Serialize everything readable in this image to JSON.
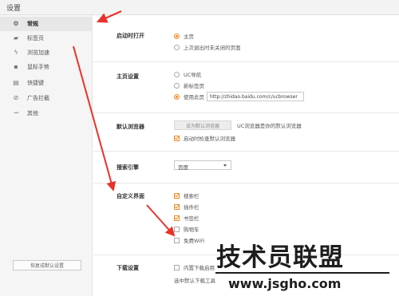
{
  "window": {
    "title": "设置"
  },
  "sidebar": {
    "items": [
      {
        "label": "常规",
        "icon": "gear-icon",
        "glyph": "⚙",
        "active": true
      },
      {
        "label": "标签页",
        "icon": "tab-icon",
        "glyph": "▰",
        "active": false
      },
      {
        "label": "浏览加速",
        "icon": "lightning-icon",
        "glyph": "ϟ",
        "active": false
      },
      {
        "label": "鼠标手势",
        "icon": "mouse-icon",
        "glyph": "▪",
        "active": false
      },
      {
        "label": "快捷键",
        "icon": "keyboard-icon",
        "glyph": "▤",
        "active": false
      },
      {
        "label": "广告拦截",
        "icon": "block-icon",
        "glyph": "⊘",
        "active": false
      },
      {
        "label": "其他",
        "icon": "more-icon",
        "glyph": "•••",
        "active": false
      }
    ],
    "restore_label": "恢复成默认设置"
  },
  "startup": {
    "label": "启动时打开",
    "options": [
      {
        "label": "主页",
        "selected": true
      },
      {
        "label": "上次退出时未关闭的页面",
        "selected": false
      }
    ]
  },
  "homepage": {
    "label": "主页设置",
    "options": [
      {
        "label": "UC导航",
        "selected": false
      },
      {
        "label": "新标签页",
        "selected": false
      },
      {
        "label": "使用此页",
        "selected": true
      }
    ],
    "url_value": "http://zhidao.baidu.com/c/ucbrowser"
  },
  "default_browser": {
    "label": "默认浏览器",
    "button_label": "设为默认浏览器",
    "status_text": "UC浏览器是你的默认浏览器",
    "check_label": "启动时检查默认浏览器",
    "check_on": true
  },
  "search_engine": {
    "label": "搜索引擎",
    "selected": "百度"
  },
  "custom_ui": {
    "label": "自定义界面",
    "items": [
      {
        "label": "搜索栏",
        "checked": true
      },
      {
        "label": "插件栏",
        "checked": true
      },
      {
        "label": "书签栏",
        "checked": true
      },
      {
        "label": "购物车",
        "checked": false
      },
      {
        "label": "免费WiFi",
        "checked": false
      }
    ]
  },
  "download": {
    "label": "下载设置",
    "line1": "内置下载启用",
    "line2": "选中默认下载工具"
  },
  "watermark": {
    "text_cn": "技术员联盟",
    "text_url": "www.jsgho.com"
  },
  "colors": {
    "accent": "#f08a24",
    "arrow": "#e8332a"
  }
}
